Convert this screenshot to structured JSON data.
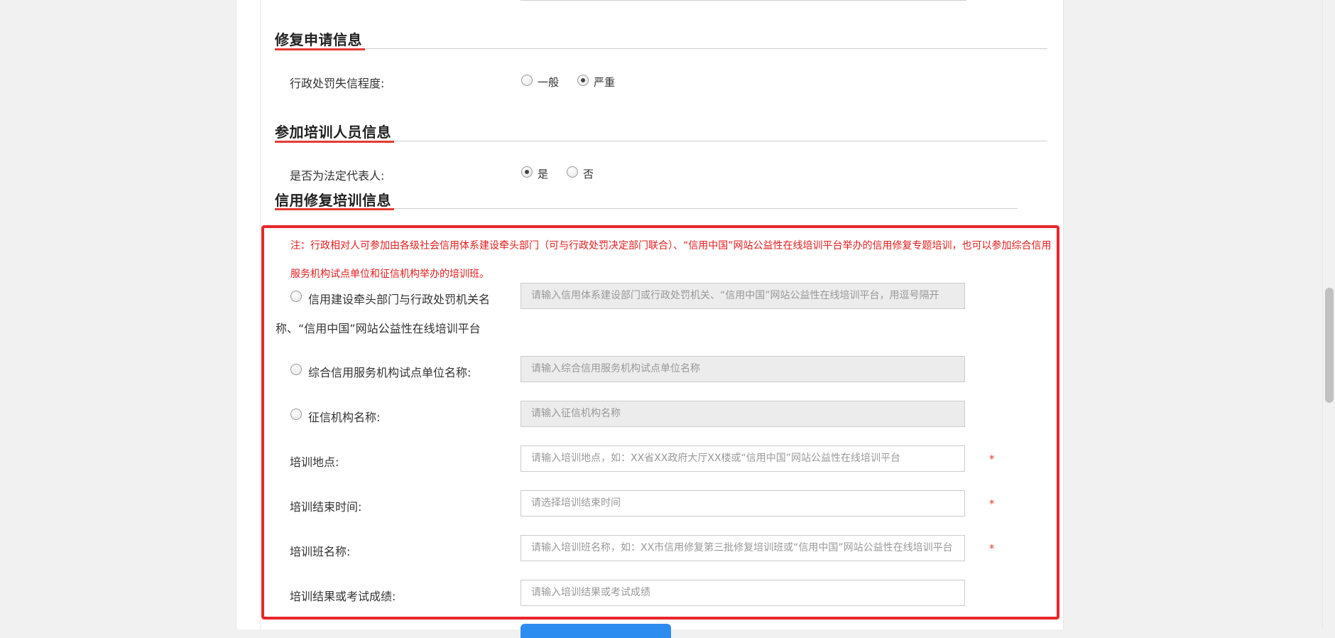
{
  "sections": {
    "repair_application": "修复申请信息",
    "training_participant": "参加培训人员信息",
    "credit_repair_training": "信用修复培训信息"
  },
  "penalty_level": {
    "label": "行政处罚失信程度:",
    "options": [
      "一般",
      "严重"
    ],
    "selected": "严重"
  },
  "legal_rep": {
    "label": "是否为法定代表人:",
    "options": [
      "是",
      "否"
    ],
    "selected": "是"
  },
  "note": "注：行政相对人可参加由各级社会信用体系建设牵头部门（可与行政处罚决定部门联合）、“信用中国”网站公益性在线培训平台举办的信用修复专题培训，也可以参加综合信用服务机构试点单位和征信机构举办的培训班。",
  "fields": {
    "lead_dept": {
      "label_line1": "信用建设牵头部门与行政处罚机关名",
      "label_line2": "称、“信用中国”网站公益性在线培训平台",
      "placeholder": "请输入信用体系建设部门或行政处罚机关、“信用中国”网站公益性在线培训平台，用逗号隔开"
    },
    "pilot_unit": {
      "label": "综合信用服务机构试点单位名称:",
      "placeholder": "请输入综合信用服务机构试点单位名称"
    },
    "credit_agency": {
      "label": "征信机构名称:",
      "placeholder": "请输入征信机构名称"
    },
    "location": {
      "label": "培训地点:",
      "placeholder": "请输入培训地点，如：XX省XX政府大厅XX楼或“信用中国”网站公益性在线培训平台",
      "required_mark": "*"
    },
    "end_time": {
      "label": "培训结束时间:",
      "placeholder": "请选择培训结束时间",
      "required_mark": "*"
    },
    "class_name": {
      "label": "培训班名称:",
      "placeholder": "请输入培训班名称，如：XX市信用修复第三批修复培训班或“信用中国”网站公益性在线培训平台",
      "required_mark": "*"
    },
    "result": {
      "label": "培训结果或考试成绩:",
      "placeholder": "请输入培训结果或考试成绩"
    }
  },
  "colors": {
    "accent_red": "#e33a35",
    "note_red": "#e41e1e",
    "highlight_box": "#e8262c",
    "button_blue": "#2d8cf0"
  }
}
